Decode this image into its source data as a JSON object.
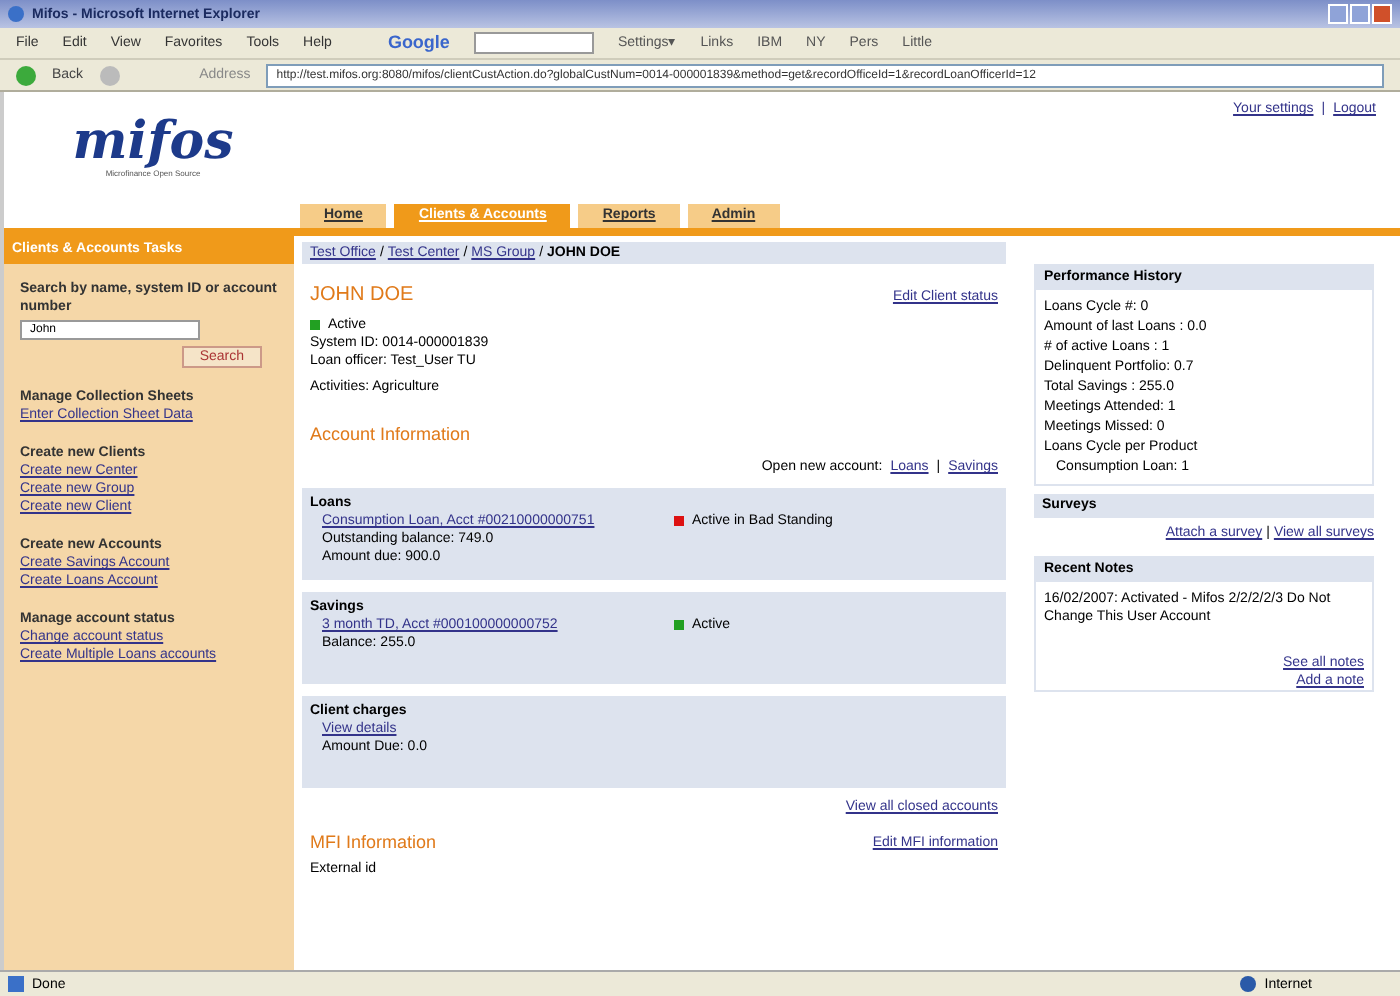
{
  "window": {
    "title": "Mifos - Microsoft Internet Explorer"
  },
  "menu": [
    "File",
    "Edit",
    "View",
    "Favorites",
    "Tools",
    "Help"
  ],
  "google_toolbar": {
    "brand": "Google",
    "items": [
      "Settings▾",
      "Links"
    ],
    "bookmarks": [
      "IBM",
      "NY",
      "Pers",
      "Little"
    ]
  },
  "nav": {
    "back": "Back",
    "address_label": "Address",
    "url": "http://test.mifos.org:8080/mifos/clientCustAction.do?globalCustNum=0014-000001839&method=get&recordOfficeId=1&recordLoanOfficerId=12"
  },
  "header": {
    "logo": "mifos",
    "tagline": "Microfinance Open Source",
    "links": [
      "Your settings",
      "Logout"
    ],
    "separator": "|"
  },
  "tabs": [
    {
      "label": "Home",
      "selected": false
    },
    {
      "label": "Clients & Accounts",
      "selected": true
    },
    {
      "label": "Reports",
      "selected": false
    },
    {
      "label": "Admin",
      "selected": false
    }
  ],
  "sidebar": {
    "title": "Clients & Accounts Tasks",
    "search_label": "Search by name, system ID or account number",
    "search_value": "John",
    "search_button": "Search",
    "groups": [
      {
        "heading": "Manage Collection Sheets",
        "links": [
          "Enter Collection Sheet Data"
        ]
      },
      {
        "heading": "Create new Clients",
        "links": [
          "Create new Center",
          "Create new Group",
          "Create new Client"
        ]
      },
      {
        "heading": "Create new Accounts",
        "links": [
          "Create Savings Account",
          "Create Loans Account"
        ]
      },
      {
        "heading": "Manage account status",
        "links": [
          "Change account status",
          "Create Multiple Loans accounts"
        ]
      }
    ]
  },
  "breadcrumb": {
    "links": [
      "Test Office",
      "Test Center",
      "MS Group"
    ],
    "current": "JOHN DOE",
    "separator": "/"
  },
  "client": {
    "name": "JOHN DOE",
    "edit_link": "Edit Client status",
    "status": {
      "label": "Active",
      "color": "#22a022"
    },
    "details": [
      "System ID: 0014-000001839",
      "Loan officer: Test_User TU",
      "Activities: Agriculture"
    ]
  },
  "account_info": {
    "heading": "Account Information",
    "open_label": "Open new account:",
    "open_links": [
      "Loans",
      "Savings"
    ],
    "separator": "|",
    "sections": [
      {
        "title": "Loans",
        "accounts": [
          {
            "link": "Consumption Loan, Acct #00210000000751",
            "status": "Active in Bad Standing",
            "color": "#dd1111",
            "lines": [
              "Outstanding balance: 749.0",
              "Amount due: 900.0"
            ]
          }
        ]
      },
      {
        "title": "Savings",
        "accounts": [
          {
            "link": "3 month TD, Acct #000100000000752",
            "status": "Active",
            "color": "#22a022",
            "lines": [
              "Balance: 255.0"
            ]
          }
        ]
      },
      {
        "title": "Client charges",
        "accounts": [
          {
            "link": "View details",
            "lines": [
              "Amount Due: 0.0"
            ]
          }
        ]
      }
    ],
    "closed_link": "View all closed accounts"
  },
  "mfi": {
    "heading": "MFI Information",
    "edit_link": "Edit MFI information",
    "line": "External id"
  },
  "performance": {
    "title": "Performance History",
    "lines": [
      "Loans Cycle #: 0",
      "Amount of last Loans : 0.0",
      "# of active Loans : 1",
      "Delinquent Portfolio: 0.7",
      "Total Savings : 255.0",
      "Meetings Attended: 1",
      "Meetings Missed: 0",
      "Loans Cycle per Product"
    ],
    "sub_lines": [
      "Consumption Loan: 1"
    ]
  },
  "surveys": {
    "title": "Surveys",
    "links": [
      "Attach a survey",
      "View all surveys"
    ],
    "separator": "|"
  },
  "notes": {
    "title": "Recent Notes",
    "note": "16/02/2007: Activated - Mifos 2/2/2/2/3 Do Not Change This User Account",
    "links": [
      "See all notes",
      "Add a note"
    ]
  },
  "status_bar": {
    "text": "Done",
    "zone": "Internet"
  }
}
